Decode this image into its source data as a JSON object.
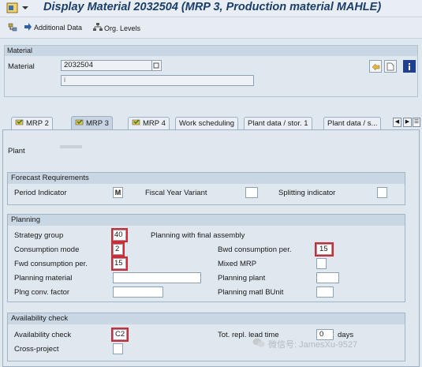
{
  "window": {
    "title": "Display Material 2032504 (MRP 3, Production material MAHLE)"
  },
  "toolbar": {
    "additional_data": "Additional Data",
    "org_levels": "Org. Levels"
  },
  "material_section": {
    "title": "Material",
    "material_label": "Material",
    "material_value": "2032504",
    "description_value": "i"
  },
  "tabs": [
    {
      "label": "MRP 2"
    },
    {
      "label": "MRP 3"
    },
    {
      "label": "MRP 4"
    },
    {
      "label": "Work scheduling"
    },
    {
      "label": "Plant data / stor. 1"
    },
    {
      "label": "Plant data / s..."
    }
  ],
  "plant": {
    "label": "Plant"
  },
  "forecast": {
    "title": "Forecast Requirements",
    "period_indicator_label": "Period Indicator",
    "period_indicator_value": "M",
    "fiscal_year_variant_label": "Fiscal Year Variant",
    "splitting_indicator_label": "Splitting indicator"
  },
  "planning": {
    "title": "Planning",
    "strategy_group_label": "Strategy group",
    "strategy_group_value": "40",
    "strategy_group_text": "Planning with final assembly",
    "consumption_mode_label": "Consumption mode",
    "consumption_mode_value": "2",
    "bwd_consumption_label": "Bwd consumption per.",
    "bwd_consumption_value": "15",
    "fwd_consumption_label": "Fwd consumption per.",
    "fwd_consumption_value": "15",
    "mixed_mrp_label": "Mixed MRP",
    "planning_material_label": "Planning material",
    "planning_plant_label": "Planning plant",
    "plng_conv_factor_label": "Plng conv. factor",
    "planning_matl_bunit_label": "Planning matl BUnit"
  },
  "availability": {
    "title": "Availability check",
    "availability_check_label": "Availability check",
    "availability_check_value": "C2",
    "tot_repl_lead_time_label": "Tot. repl. lead time",
    "tot_repl_lead_time_value": "0",
    "days_label": "days",
    "cross_project_label": "Cross-project"
  },
  "watermark": {
    "text": "微信号: JamesXu-9527"
  },
  "colors": {
    "highlight": "#d9262f",
    "title": "#1c3f6a",
    "panel_header": "#c9d6e3"
  }
}
